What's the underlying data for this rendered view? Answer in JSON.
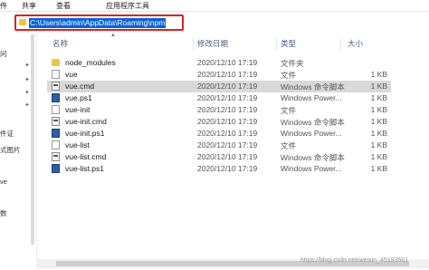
{
  "ribbon": {
    "tabs": [
      "件",
      "共享",
      "查看",
      "应用程序工具"
    ]
  },
  "address_bar": {
    "path": "C:\\Users\\admin\\AppData\\Roaming\\npm"
  },
  "left_pane": {
    "items": [
      "问",
      "件证",
      "式图片",
      "ve",
      "数"
    ]
  },
  "columns": {
    "name": "名称",
    "date": "修改日期",
    "type": "类型",
    "size": "大小"
  },
  "files": [
    {
      "name": "node_modules",
      "date": "2020/12/10 17:19",
      "type": "文件夹",
      "size": "",
      "icon": "folder-icon"
    },
    {
      "name": "vue",
      "date": "2020/12/10 17:19",
      "type": "文件",
      "size": "1 KB",
      "icon": "file-icon"
    },
    {
      "name": "vue.cmd",
      "date": "2020/12/10 17:19",
      "type": "Windows 命令脚本",
      "size": "1 KB",
      "icon": "cmd-icon",
      "selected": true
    },
    {
      "name": "vue.ps1",
      "date": "2020/12/10 17:19",
      "type": "Windows Power...",
      "size": "1 KB",
      "icon": "powershell-icon"
    },
    {
      "name": "vue-init",
      "date": "2020/12/10 17:19",
      "type": "文件",
      "size": "1 KB",
      "icon": "file-icon"
    },
    {
      "name": "vue-init.cmd",
      "date": "2020/12/10 17:19",
      "type": "Windows 命令脚本",
      "size": "1 KB",
      "icon": "cmd-icon"
    },
    {
      "name": "vue-init.ps1",
      "date": "2020/12/10 17:19",
      "type": "Windows Power...",
      "size": "1 KB",
      "icon": "powershell-icon"
    },
    {
      "name": "vue-list",
      "date": "2020/12/10 17:19",
      "type": "文件",
      "size": "1 KB",
      "icon": "file-icon"
    },
    {
      "name": "vue-list.cmd",
      "date": "2020/12/10 17:19",
      "type": "Windows 命令脚本",
      "size": "1 KB",
      "icon": "cmd-icon"
    },
    {
      "name": "vue-list.ps1",
      "date": "2020/12/10 17:19",
      "type": "Windows Power...",
      "size": "1 KB",
      "icon": "powershell-icon"
    }
  ],
  "watermark": "https://blog.csdn.net/weixin_45193561",
  "colors": {
    "selection": "#d9d9d9",
    "address_highlight": "#0a63d6",
    "annotation_border": "#e02020",
    "folder": "#f1c24b"
  }
}
